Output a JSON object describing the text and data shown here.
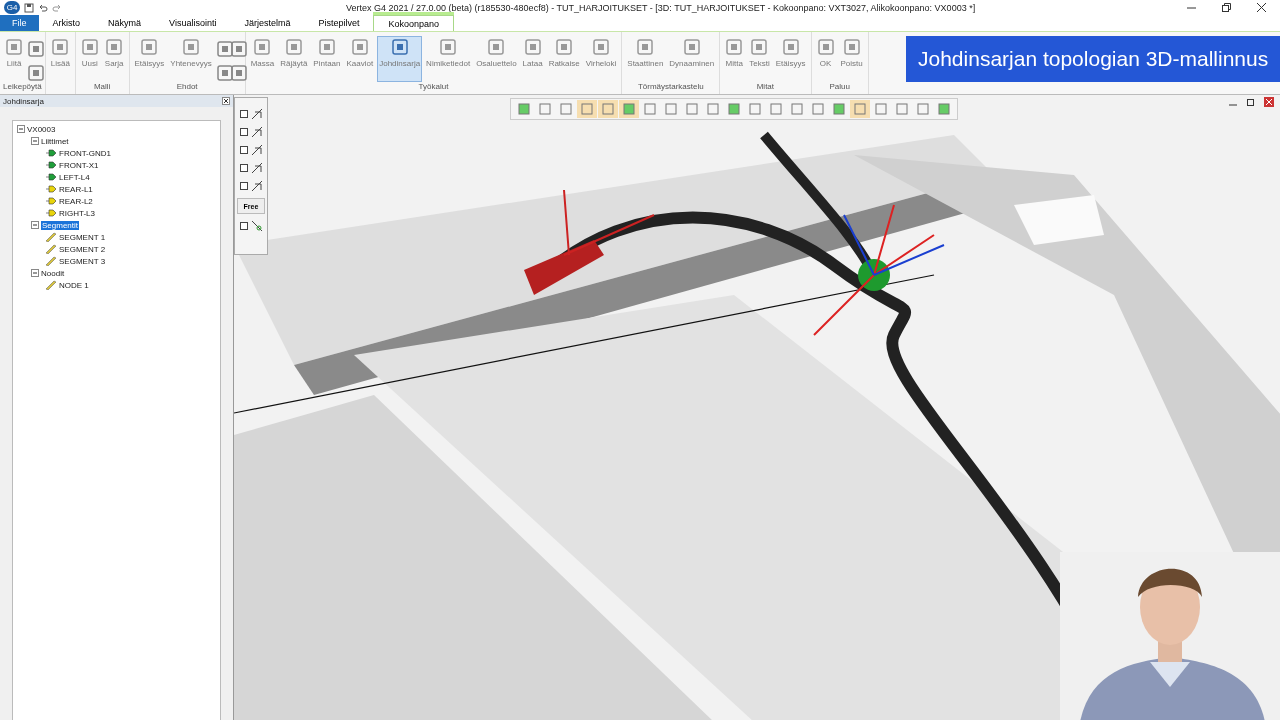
{
  "window": {
    "title": "Vertex G4 2021 / 27.0.00 (beta) (r185530-480ecf8) - TUT_HARJOITUKSET - [3D: TUT_HARJOITUKSET - Kokoonpano: VXT3027, Alikokoonpano: VX0003 *]",
    "app_badge": "G4"
  },
  "tabs": [
    {
      "label": "File",
      "kind": "file",
      "selected": false
    },
    {
      "label": "Arkisto",
      "kind": "tab",
      "selected": false
    },
    {
      "label": "Näkymä",
      "kind": "tab",
      "selected": false
    },
    {
      "label": "Visualisointi",
      "kind": "tab",
      "selected": false
    },
    {
      "label": "Järjestelmä",
      "kind": "tab",
      "selected": false
    },
    {
      "label": "Pistepilvet",
      "kind": "tab",
      "selected": false
    },
    {
      "label": "Kokoonpano",
      "kind": "tab",
      "selected": true
    }
  ],
  "ribbon": [
    {
      "label": "Leikepöytä",
      "buttons": [
        {
          "label": "Liitä",
          "kind": "large"
        },
        {
          "kind": "small"
        }
      ]
    },
    {
      "buttons": [
        {
          "label": "Lisää",
          "kind": "large"
        }
      ]
    },
    {
      "label": "Malli",
      "buttons": [
        {
          "label": "Uusi",
          "kind": "large"
        },
        {
          "label": "Sarja",
          "kind": "large"
        }
      ]
    },
    {
      "label": "Ehdot",
      "buttons": [
        {
          "label": "Etäisyys",
          "kind": "large"
        },
        {
          "label": "Yhtenevyys",
          "kind": "large"
        },
        {
          "kind": "small"
        },
        {
          "kind": "small"
        }
      ]
    },
    {
      "label": "Työkalut",
      "buttons": [
        {
          "label": "Massa",
          "kind": "large"
        },
        {
          "label": "Räjäytä",
          "kind": "large"
        },
        {
          "label": "Pintaan",
          "kind": "large"
        },
        {
          "label": "Kaaviot",
          "kind": "large"
        },
        {
          "label": "Johdinsarja",
          "kind": "large",
          "active": true
        },
        {
          "label": "Nimiketiedot",
          "kind": "large"
        },
        {
          "label": "Osaluettelo",
          "kind": "large"
        },
        {
          "label": "Lataa",
          "kind": "large"
        },
        {
          "label": "Ratkaise",
          "kind": "large"
        },
        {
          "label": "Virheloki",
          "kind": "large"
        }
      ]
    },
    {
      "label": "Törmäystarkastelu",
      "buttons": [
        {
          "label": "Staattinen",
          "kind": "large"
        },
        {
          "label": "Dynaaminen",
          "kind": "large"
        }
      ]
    },
    {
      "label": "Mitat",
      "buttons": [
        {
          "label": "Mitta",
          "kind": "large"
        },
        {
          "label": "Teksti",
          "kind": "large"
        },
        {
          "label": "Etäisyys",
          "kind": "large"
        }
      ]
    },
    {
      "label": "Paluu",
      "buttons": [
        {
          "label": "OK",
          "kind": "large"
        },
        {
          "label": "Poistu",
          "kind": "large"
        }
      ]
    }
  ],
  "banner": "Johdinsarjan topologian 3D-mallinnus",
  "panel": {
    "title": "Johdinsarja",
    "tree": [
      {
        "label": "VX0003",
        "kind": "root",
        "selected": false,
        "children": [
          {
            "label": "Liittimet",
            "kind": "group",
            "selected": false,
            "children": [
              {
                "label": "FRONT-GND1",
                "kind": "connector",
                "color": "#1f9e3a",
                "selected": false
              },
              {
                "label": "FRONT-X1",
                "kind": "connector",
                "color": "#1f9e3a",
                "selected": false
              },
              {
                "label": "LEFT-L4",
                "kind": "connector",
                "color": "#1f9e3a",
                "selected": false
              },
              {
                "label": "REAR-L1",
                "kind": "connector",
                "color": "#e8d40c",
                "selected": false
              },
              {
                "label": "REAR-L2",
                "kind": "connector",
                "color": "#e8d40c",
                "selected": false
              },
              {
                "label": "RIGHT-L3",
                "kind": "connector",
                "color": "#e8d40c",
                "selected": false
              }
            ]
          },
          {
            "label": "Segmentit",
            "kind": "group",
            "selected": true,
            "children": [
              {
                "label": "SEGMENT 1",
                "kind": "segment",
                "selected": false
              },
              {
                "label": "SEGMENT 2",
                "kind": "segment",
                "selected": false
              },
              {
                "label": "SEGMENT 3",
                "kind": "segment",
                "selected": false
              }
            ]
          },
          {
            "label": "Noodit",
            "kind": "group",
            "selected": false,
            "children": [
              {
                "label": "NODE 1",
                "kind": "segment",
                "selected": false
              }
            ]
          }
        ]
      }
    ]
  },
  "constraint_palette": {
    "rows": [
      {
        "checked": false
      },
      {
        "checked": false
      },
      {
        "checked": false
      },
      {
        "checked": false
      },
      {
        "checked": false
      }
    ],
    "free_label": "Free",
    "last_checked": false
  },
  "view_toolbar": [
    {
      "selected": false
    },
    {
      "selected": false
    },
    {
      "selected": false
    },
    {
      "selected": true
    },
    {
      "selected": true
    },
    {
      "selected": true
    },
    {
      "selected": false
    },
    {
      "selected": false
    },
    {
      "selected": false
    },
    {
      "selected": false
    },
    {
      "selected": false
    },
    {
      "selected": false
    },
    {
      "selected": false
    },
    {
      "selected": false
    },
    {
      "selected": false
    },
    {
      "selected": false
    },
    {
      "selected": true
    },
    {
      "selected": false
    },
    {
      "selected": false
    },
    {
      "selected": false
    },
    {
      "selected": false
    }
  ]
}
